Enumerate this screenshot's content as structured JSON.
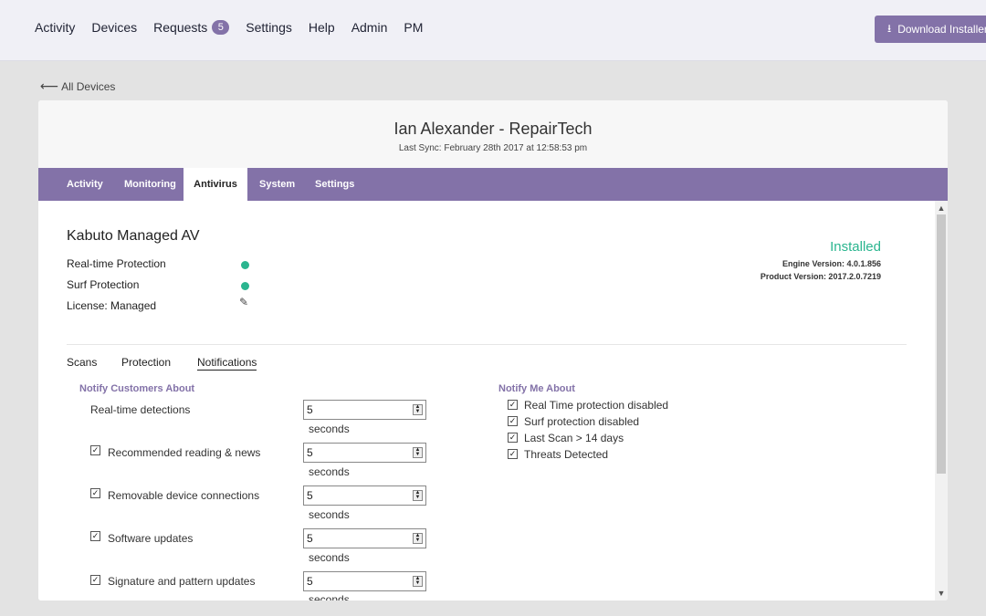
{
  "nav": {
    "items": [
      {
        "label": "Activity"
      },
      {
        "label": "Devices"
      },
      {
        "label": "Requests",
        "badge": "5"
      },
      {
        "label": "Settings"
      },
      {
        "label": "Help"
      },
      {
        "label": "Admin"
      },
      {
        "label": "PM"
      }
    ],
    "download_label": "Download Installer"
  },
  "back_label": "All Devices",
  "device": {
    "title": "Ian Alexander - RepairTech",
    "last_sync": "Last Sync: February 28th 2017 at 12:58:53 pm"
  },
  "tabs": [
    {
      "label": "Activity"
    },
    {
      "label": "Monitoring"
    },
    {
      "label": "Antivirus",
      "active": true
    },
    {
      "label": "System"
    },
    {
      "label": "Settings"
    }
  ],
  "av": {
    "title": "Kabuto Managed AV",
    "rows": [
      {
        "label": "Real-time Protection",
        "indicator": "green-dot"
      },
      {
        "label": "Surf Protection",
        "indicator": "green-dot"
      },
      {
        "label": "License: Managed",
        "indicator": "pencil-icon"
      }
    ],
    "status": "Installed",
    "engine_version": "Engine Version: 4.0.1.856",
    "product_version": "Product Version: 2017.2.0.7219",
    "status_color": "#2ab58f"
  },
  "subtabs": [
    {
      "label": "Scans"
    },
    {
      "label": "Protection"
    },
    {
      "label": "Notifications",
      "active": true
    }
  ],
  "notify_customers": {
    "title": "Notify Customers About",
    "items": [
      {
        "label": "Real-time detections",
        "checkbox": false,
        "value": "5",
        "unit": "seconds"
      },
      {
        "label": "Recommended reading & news",
        "checkbox": true,
        "value": "5",
        "unit": "seconds"
      },
      {
        "label": "Removable device connections",
        "checkbox": true,
        "value": "5",
        "unit": "seconds"
      },
      {
        "label": "Software updates",
        "checkbox": true,
        "value": "5",
        "unit": "seconds"
      },
      {
        "label": "Signature and pattern updates",
        "checkbox": true,
        "value": "5",
        "unit": "seconds"
      }
    ]
  },
  "notify_me": {
    "title": "Notify Me About",
    "items": [
      {
        "label": "Real Time protection disabled",
        "checked": true
      },
      {
        "label": "Surf protection disabled",
        "checked": true
      },
      {
        "label": "Last Scan > 14 days",
        "checked": true
      },
      {
        "label": "Threats Detected",
        "checked": true
      }
    ]
  },
  "colors": {
    "accent": "#8372a8",
    "success": "#2ab58f"
  }
}
